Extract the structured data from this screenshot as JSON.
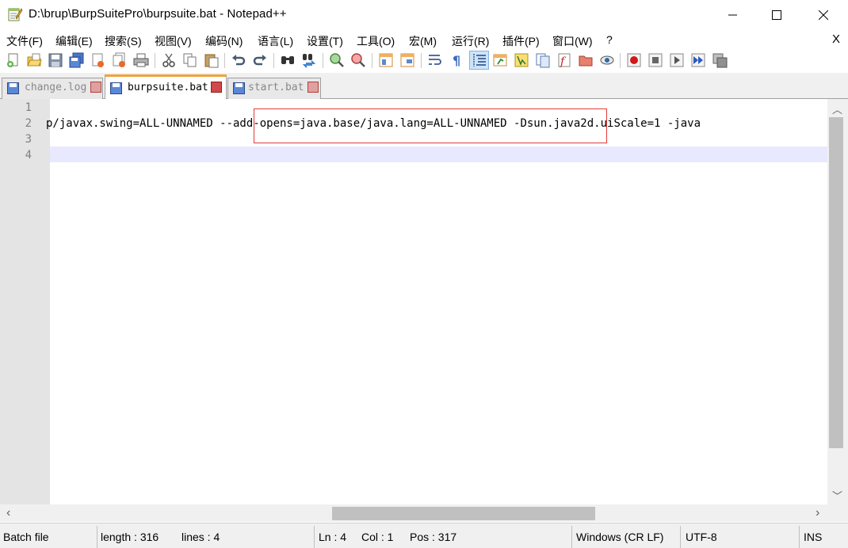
{
  "window": {
    "title": "D:\\brup\\BurpSuitePro\\burpsuite.bat - Notepad++"
  },
  "menu": {
    "items": [
      "文件(F)",
      "编辑(E)",
      "搜索(S)",
      "视图(V)",
      "编码(N)",
      "语言(L)",
      "设置(T)",
      "工具(O)",
      "宏(M)",
      "运行(R)",
      "插件(P)",
      "窗口(W)",
      "?"
    ],
    "close_label": "X"
  },
  "toolbar": {
    "icons": [
      "new-file-icon",
      "open-file-icon",
      "save-icon",
      "save-all-icon",
      "close-icon",
      "close-all-icon",
      "print-icon",
      "cut-icon",
      "copy-icon",
      "paste-icon",
      "undo-icon",
      "redo-icon",
      "find-icon",
      "replace-icon",
      "zoom-in-icon",
      "zoom-out-icon",
      "sync-vertical-icon",
      "sync-horizontal-icon",
      "word-wrap-icon",
      "show-all-chars-icon",
      "indent-guide-icon",
      "user-language-icon",
      "doc-map-icon",
      "doc-list-icon",
      "function-list-icon",
      "folder-workspace-icon",
      "monitor-icon",
      "record-macro-icon",
      "stop-macro-icon",
      "play-macro-icon",
      "run-macro-multiple-icon",
      "save-macro-icon"
    ]
  },
  "tabs": [
    {
      "label": "change.log",
      "active": false
    },
    {
      "label": "burpsuite.bat",
      "active": true
    },
    {
      "label": "start.bat",
      "active": false
    }
  ],
  "editor": {
    "line_numbers": [
      "1",
      "2",
      "3",
      "4"
    ],
    "lines": [
      "",
      "p/javax.swing=ALL-UNNAMED --add-opens=java.base/java.lang=ALL-UNNAMED -Dsun.java2d.uiScale=1 -java",
      "",
      ""
    ]
  },
  "status": {
    "file_type": "Batch file",
    "length": "length : 316",
    "lines": "lines : 4",
    "ln": "Ln : 4",
    "col": "Col : 1",
    "pos": "Pos : 317",
    "eol": "Windows (CR LF)",
    "encoding": "UTF-8",
    "mode": "INS"
  },
  "colors": {
    "tab_accent": "#f0a23a",
    "highlight_box": "#e23b3b",
    "current_line": "#e8e8ff"
  }
}
